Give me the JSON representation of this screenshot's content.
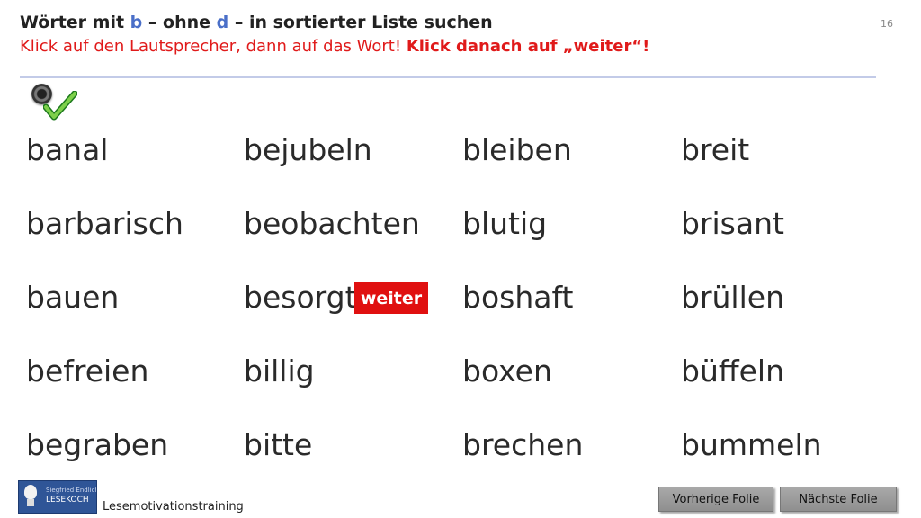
{
  "header": {
    "title_part1": "Wörter mit ",
    "title_b": "b",
    "title_part2": " – ohne ",
    "title_d": "d",
    "title_part3": " – in sortierter Liste suchen",
    "instruction_normal": "Klick auf den Lautsprecher, dann auf das Wort! ",
    "instruction_bold": "Klick danach auf „weiter“!",
    "slide_number": "16"
  },
  "words": {
    "col1": [
      "banal",
      "barbarisch",
      "bauen",
      "befreien",
      "begraben"
    ],
    "col2": [
      "bejubeln",
      "beobachten",
      "besorgt",
      "billig",
      "bitte"
    ],
    "col3": [
      "bleiben",
      "blutig",
      "boshaft",
      "boxen",
      "brechen"
    ],
    "col4": [
      "breit",
      "brisant",
      "brüllen",
      "büffeln",
      "bummeln"
    ]
  },
  "weiter_button": "weiter",
  "footer": {
    "logo_line1": "Siegfried Endlichs",
    "logo_line2": "LESEKOCH",
    "label": "Lesemotivationstraining",
    "prev_button": "Vorherige  Folie",
    "next_button": "Nächste  Folie"
  },
  "colors": {
    "accent_blue": "#4a6fc8",
    "accent_red": "#e01a1a",
    "button_red": "#e01010"
  },
  "icons": [
    "speaker-icon",
    "checkmark-icon",
    "lightbulb-icon"
  ]
}
